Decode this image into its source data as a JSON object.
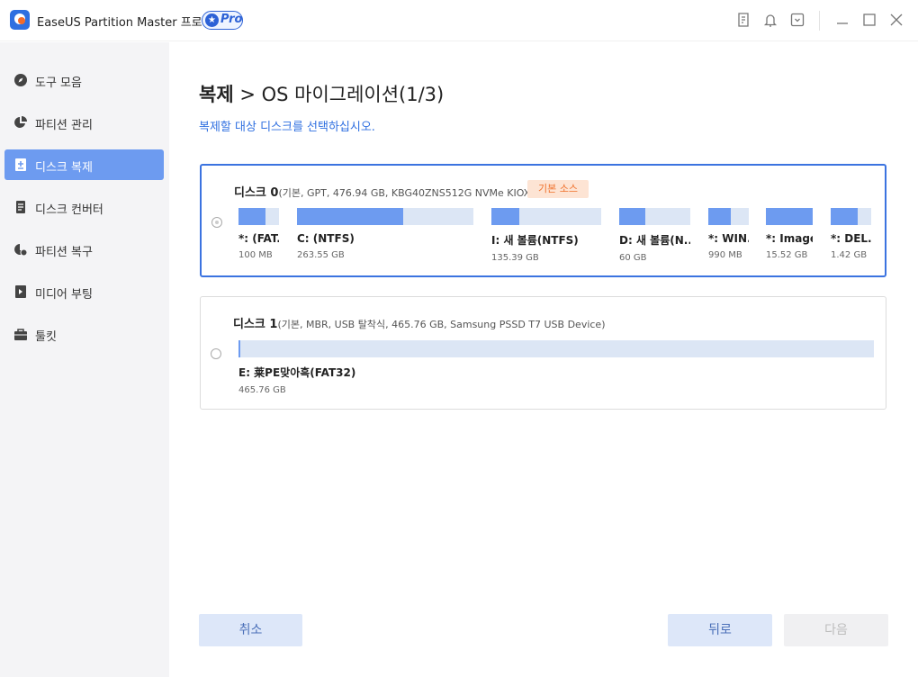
{
  "app": {
    "title": "EaseUS Partition Master 프로 버전",
    "badge": "Pro"
  },
  "titlebar_icons": [
    "feedback-icon",
    "bell-icon",
    "dropdown-menu-icon",
    "minimize-icon",
    "maximize-icon",
    "close-icon"
  ],
  "sidebar": {
    "items": [
      {
        "label": "도구 모음",
        "icon": "compass-icon",
        "active": false
      },
      {
        "label": "파티션 관리",
        "icon": "pie-chart-icon",
        "active": false
      },
      {
        "label": "디스크 복제",
        "icon": "disk-clone-icon",
        "active": true
      },
      {
        "label": "디스크 컨버터",
        "icon": "converter-icon",
        "active": false
      },
      {
        "label": "파티션 복구",
        "icon": "partition-recovery-icon",
        "active": false
      },
      {
        "label": "미디어 부팅",
        "icon": "bootable-media-icon",
        "active": false
      },
      {
        "label": "툴킷",
        "icon": "toolkit-icon",
        "active": false
      }
    ]
  },
  "main": {
    "title_bold": "복제",
    "title_rest": " > OS 마이그레이션(1/3)",
    "subtitle": "복제할 대상 디스크를 선택하십시오."
  },
  "disks": [
    {
      "name": "디스크 0",
      "info": "(기본, GPT, 476.94 GB, KBG40ZNS512G NVMe KIOXIA 512GB )",
      "badge": "기본 소스",
      "selected": true,
      "partitions": [
        {
          "label": "*: (FAT...",
          "size": "100 MB",
          "used_fraction": 0.67
        },
        {
          "label": "C: (NTFS)",
          "size": "263.55 GB",
          "used_fraction": 0.6
        },
        {
          "label": "I: 새 볼륨(NTFS)",
          "size": "135.39 GB",
          "used_fraction": 0.25
        },
        {
          "label": "D: 새 볼륨(N...",
          "size": "60 GB",
          "used_fraction": 0.37
        },
        {
          "label": "*: WIN...",
          "size": "990 MB",
          "used_fraction": 0.55
        },
        {
          "label": "*: Image...",
          "size": "15.52 GB",
          "used_fraction": 1.0
        },
        {
          "label": "*: DEL...",
          "size": "1.42 GB",
          "used_fraction": 0.66
        }
      ]
    },
    {
      "name": "디스크 1",
      "info": "(기본, MBR, USB 탈착식, 465.76 GB, Samsung  PSSD T7        USB Device)",
      "selected": false,
      "partitions": [
        {
          "label": "E: 莱PE맞아흑(FAT32)",
          "size": "465.76 GB",
          "used_fraction": 0.003
        }
      ]
    }
  ],
  "buttons": {
    "cancel": "취소",
    "back": "뒤로",
    "next": "다음"
  },
  "colors": {
    "accent": "#2f6fe0",
    "partition_fill": "#6d9bf0",
    "partition_bg": "#dce6f5",
    "source_badge_bg": "#fde4d4",
    "source_badge_text": "#f0702a"
  }
}
